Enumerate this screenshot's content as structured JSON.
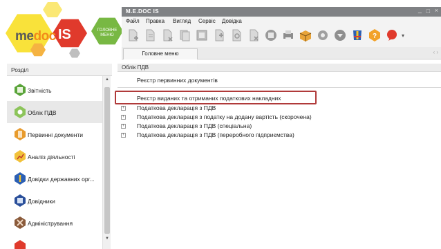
{
  "logo": {
    "me": "me",
    "doc": "doc",
    "is": "IS",
    "menu_label_1": "ГОЛОВНЕ",
    "menu_label_2": "МЕНЮ"
  },
  "window": {
    "title": "M.E.DOC IS",
    "minimize": "_",
    "maximize": "□",
    "close": "×"
  },
  "menubar": [
    "Файл",
    "Правка",
    "Вигляд",
    "Сервіс",
    "Довідка"
  ],
  "toolbar_icons": [
    "new-document-icon",
    "edit-document-icon",
    "copy-document-icon",
    "delete-document-icon",
    "print-icon",
    "add-icon",
    "find-icon",
    "remove-icon",
    "archive-icon",
    "printer-icon",
    "box-icon",
    "settings-icon",
    "export-icon",
    "ua-flag-icon",
    "help-icon",
    "chat-icon"
  ],
  "tabs": [
    {
      "label": "Головне меню"
    }
  ],
  "left_panel": {
    "header": "Розділ",
    "items": [
      {
        "label": "Звітність",
        "icon": "reports-icon",
        "color": "#5aa43a"
      },
      {
        "label": "Облік ПДВ",
        "icon": "vat-icon",
        "color": "#7fb44a"
      },
      {
        "label": "Первинні документи",
        "icon": "primary-docs-icon",
        "color": "#e89b2c"
      },
      {
        "label": "Аналіз діяльності",
        "icon": "analysis-icon",
        "color": "#d9a02a"
      },
      {
        "label": "Довідки державних орг...",
        "icon": "state-references-icon",
        "color": "#2b5fb4"
      },
      {
        "label": "Довідники",
        "icon": "directories-icon",
        "color": "#2a4f9a"
      },
      {
        "label": "Адміністрування",
        "icon": "admin-icon",
        "color": "#8a5a3a"
      }
    ]
  },
  "right_panel": {
    "header": "Облік ПДВ",
    "top_items": [
      "Реєстр первинних документів",
      "Реєстр виданих та отриманих податкових накладних"
    ],
    "tree_items": [
      "Податкова декларація з ПДВ",
      "Податкова декларація з податку на додану вартість (скорочена)",
      "Податкова декларація з ПДВ (спеціальна)",
      "Податкова декларація з ПДВ (переробного підприємства)"
    ]
  },
  "colors": {
    "highlight_border": "#b03a3a",
    "title_bar": "#7f8184",
    "logo_orange": "#f28a1a",
    "logo_green": "#78b843"
  }
}
